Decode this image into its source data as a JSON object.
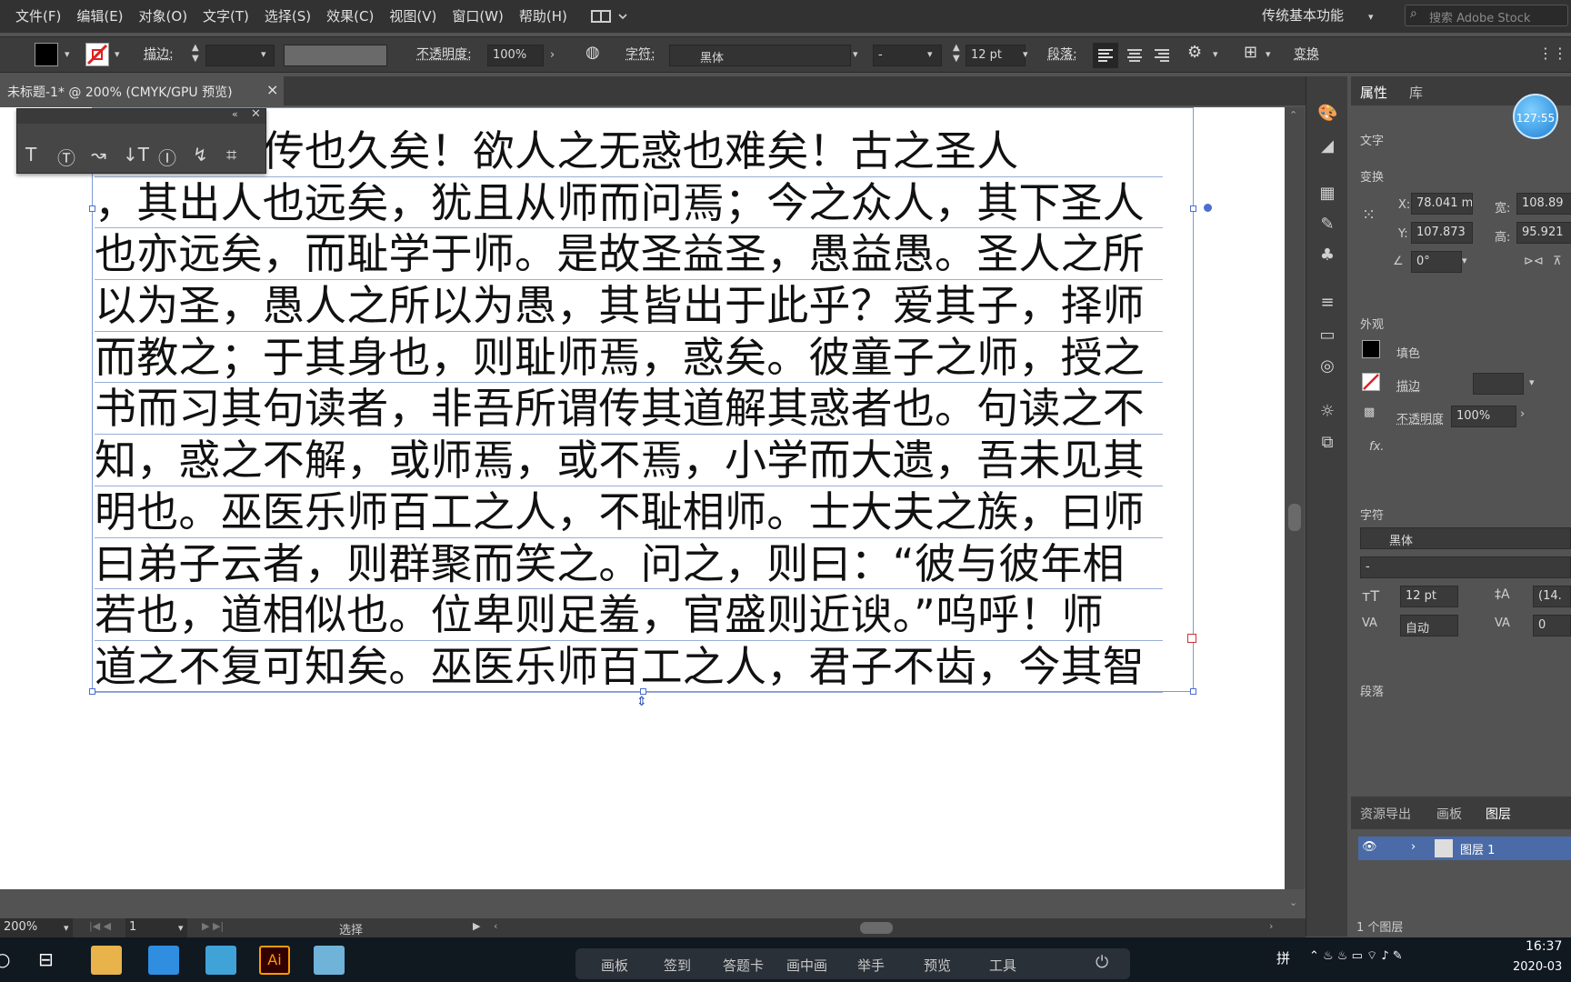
{
  "menubar": {
    "items": [
      "文件(F)",
      "编辑(E)",
      "对象(O)",
      "文字(T)",
      "选择(S)",
      "效果(C)",
      "视图(V)",
      "窗口(W)",
      "帮助(H)"
    ],
    "workspace": "传统基本功能",
    "search_placeholder": "搜索 Adobe Stock"
  },
  "control": {
    "stroke_label": "描边:",
    "opacity_label": "不透明度:",
    "opacity_value": "100%",
    "char_label": "字符:",
    "font_name": "黑体",
    "font_style": "-",
    "font_size": "12 pt",
    "para_label": "段落:",
    "transform_label": "变换"
  },
  "doc_tab": {
    "title": "未标题-1* @ 200% (CMYK/GPU 预览)",
    "close": "×"
  },
  "text_lines": [
    "师道之不传也久矣！欲人之无惑也难矣！古之圣人",
    "，其出人也远矣，犹且从师而问焉；今之众人，其下圣人",
    "也亦远矣，而耻学于师。是故圣益圣，愚益愚。圣人之所",
    "以为圣，愚人之所以为愚，其皆出于此乎？爱其子，择师",
    "而教之；于其身也，则耻师焉，惑矣。彼童子之师，授之",
    "书而习其句读者，非吾所谓传其道解其惑者也。句读之不",
    "知，惑之不解，或师焉，或不焉，小学而大遗，吾未见其",
    "明也。巫医乐师百工之人，不耻相师。士大夫之族，曰师",
    "曰弟子云者，则群聚而笑之。问之，则曰：“彼与彼年相",
    "若也，道相似也。位卑则足羞，官盛则近谀。”呜呼！师",
    "道之不复可知矣。巫医乐师百工之人，君子不齿，今其智"
  ],
  "status": {
    "zoom": "200%",
    "page": "1",
    "tool": "选择"
  },
  "panel": {
    "tabs": [
      "属性",
      "库"
    ],
    "type_label": "文字",
    "transform_label": "变换",
    "x_label": "X:",
    "x_value": "78.041 m",
    "y_label": "Y:",
    "y_value": "107.873",
    "w_label": "宽:",
    "w_value": "108.89",
    "h_label": "高:",
    "h_value": "95.921",
    "angle_value": "0°",
    "appearance_label": "外观",
    "fill_label": "填色",
    "stroke_label": "描边",
    "opacity_label": "不透明度",
    "opacity_value": "100%",
    "fx_label": "fx.",
    "char_label": "字符",
    "font_name": "黑体",
    "font_style": "-",
    "size_value": "12 pt",
    "leading_value": "(14.",
    "kerning_value": "自动",
    "tracking_value": "0",
    "para_label": "段落",
    "bottom_tabs": [
      "资源导出",
      "画板",
      "图层"
    ],
    "layer_name": "图层 1",
    "layer_count": "1 个图层"
  },
  "clock_bubble": "127:55",
  "dock": [
    "画板",
    "签到",
    "答题卡",
    "画中画",
    "举手",
    "预览",
    "工具"
  ],
  "taskbar": {
    "time": "16:37",
    "date": "2020-03",
    "ime": "拼"
  },
  "colors": {
    "menubar": "#323232",
    "workspace_bg": "#535353",
    "selection": "#4a6fcf",
    "ai_orange": "#ff9a00"
  }
}
